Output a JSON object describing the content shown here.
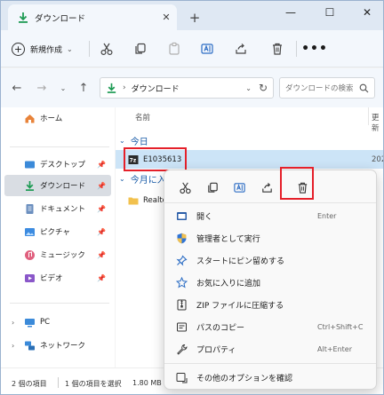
{
  "colors": {
    "accent": "#1a5ca8",
    "download_green": "#1d9a53",
    "highlight_red": "#e5202a",
    "selection_blue": "#cce4f7"
  },
  "tab": {
    "title": "ダウンロード",
    "close_glyph": "✕",
    "new_tab_glyph": "+"
  },
  "window_controls": {
    "minimize": "—",
    "maximize": "☐",
    "close": "✕"
  },
  "toolbar": {
    "new_label": "新規作成",
    "more_glyph": "•••"
  },
  "address": {
    "crumb": "ダウンロード",
    "separator": "›",
    "search_placeholder": "ダウンロードの検索"
  },
  "sidebar": {
    "items": [
      {
        "label": "ホーム",
        "icon": "home-icon"
      },
      {
        "label": "デスクトップ",
        "icon": "desktop-icon",
        "pinned": true
      },
      {
        "label": "ダウンロード",
        "icon": "download-icon",
        "pinned": true,
        "selected": true
      },
      {
        "label": "ドキュメント",
        "icon": "document-icon",
        "pinned": true
      },
      {
        "label": "ピクチャ",
        "icon": "pictures-icon",
        "pinned": true
      },
      {
        "label": "ミュージック",
        "icon": "music-icon",
        "pinned": true
      },
      {
        "label": "ビデオ",
        "icon": "video-icon",
        "pinned": true
      },
      {
        "label": "PC",
        "icon": "pc-icon"
      },
      {
        "label": "ネットワーク",
        "icon": "network-icon"
      }
    ]
  },
  "main": {
    "column_name": "名前",
    "column_date": "更新",
    "groups": [
      {
        "label": "今日",
        "files": [
          {
            "name": "E1035613",
            "date": "202"
          }
        ]
      },
      {
        "label": "今月に入",
        "files": [
          {
            "name": "Realte",
            "date": ""
          }
        ]
      }
    ]
  },
  "status": {
    "count": "2 個の項目",
    "selected": "1 個の項目を選択",
    "size": "1.80 MB"
  },
  "context_menu": {
    "items": [
      {
        "label": "開く",
        "shortcut": "Enter"
      },
      {
        "label": "管理者として実行",
        "shortcut": ""
      },
      {
        "label": "スタートにピン留めする",
        "shortcut": ""
      },
      {
        "label": "お気に入りに追加",
        "shortcut": ""
      },
      {
        "label": "ZIP ファイルに圧縮する",
        "shortcut": ""
      },
      {
        "label": "パスのコピー",
        "shortcut": "Ctrl+Shift+C"
      },
      {
        "label": "プロパティ",
        "shortcut": "Alt+Enter"
      },
      {
        "label": "その他のオプションを確認",
        "shortcut": ""
      }
    ]
  }
}
